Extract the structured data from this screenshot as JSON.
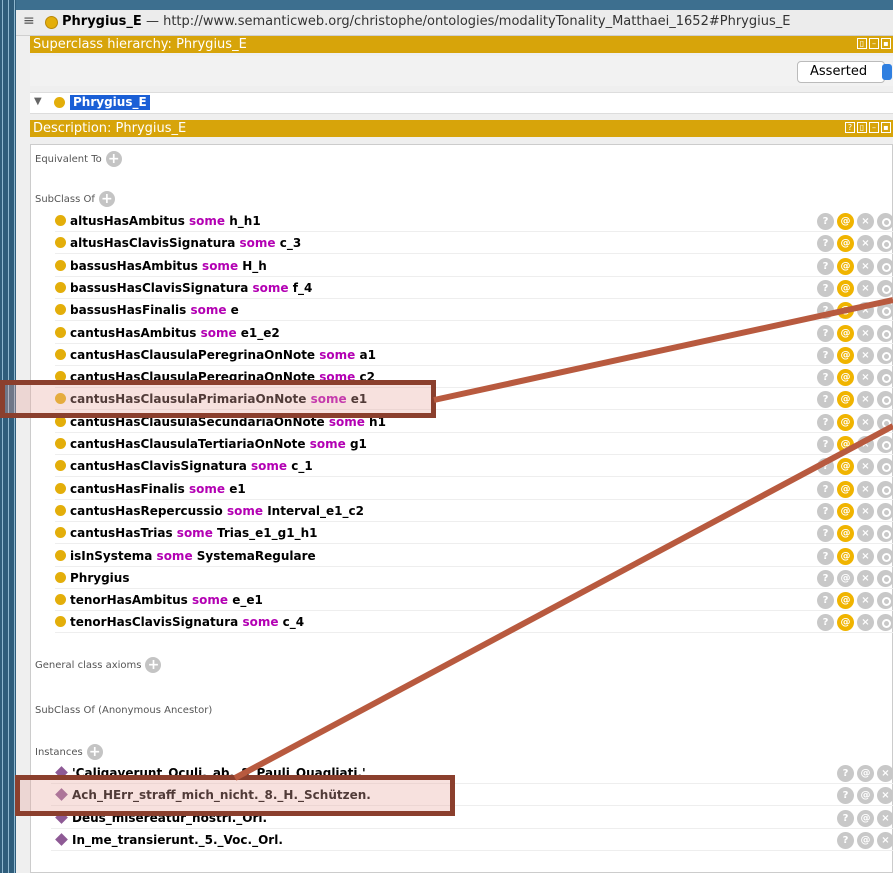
{
  "window": {
    "title_bold": "Phrygius_E",
    "title_rest": " — http://www.semanticweb.org/christophe/ontologies/modalityTonality_Matthaei_1652#Phrygius_E"
  },
  "superclass_panel": {
    "title": "Superclass hierarchy: Phrygius_E",
    "asserted_label": "Asserted",
    "tree_item": "Phrygius_E"
  },
  "description_panel": {
    "title": "Description: Phrygius_E",
    "equivalent_to": "Equivalent To",
    "subclass_of": "SubClass Of",
    "general_class_axioms": "General class axioms",
    "anonymous_ancestor": "SubClass Of (Anonymous Ancestor)",
    "instances_label": "Instances",
    "axioms": [
      {
        "prop": "altusHasAmbitus",
        "kw": "some",
        "val": "h_h1"
      },
      {
        "prop": "altusHasClavisSignatura",
        "kw": "some",
        "val": "c_3"
      },
      {
        "prop": "bassusHasAmbitus",
        "kw": "some",
        "val": "H_h"
      },
      {
        "prop": "bassusHasClavisSignatura",
        "kw": "some",
        "val": "f_4"
      },
      {
        "prop": "bassusHasFinalis",
        "kw": "some",
        "val": "e"
      },
      {
        "prop": "cantusHasAmbitus",
        "kw": "some",
        "val": "e1_e2"
      },
      {
        "prop": "cantusHasClausulaPeregrinaOnNote",
        "kw": "some",
        "val": "a1"
      },
      {
        "prop": "cantusHasClausulaPeregrinaOnNote",
        "kw": "some",
        "val": "c2"
      },
      {
        "prop": "cantusHasClausulaPrimariaOnNote",
        "kw": "some",
        "val": "e1"
      },
      {
        "prop": "cantusHasClausulaSecundariaOnNote",
        "kw": "some",
        "val": "h1"
      },
      {
        "prop": "cantusHasClausulaTertiariaOnNote",
        "kw": "some",
        "val": "g1"
      },
      {
        "prop": "cantusHasClavisSignatura",
        "kw": "some",
        "val": "c_1"
      },
      {
        "prop": "cantusHasFinalis",
        "kw": "some",
        "val": "e1"
      },
      {
        "prop": "cantusHasRepercussio",
        "kw": "some",
        "val": "Interval_e1_c2"
      },
      {
        "prop": "cantusHasTrias",
        "kw": "some",
        "val": "Trias_e1_g1_h1"
      },
      {
        "prop": "isInSystema",
        "kw": "some",
        "val": "SystemaRegulare"
      },
      {
        "prop": "Phrygius",
        "kw": "",
        "val": ""
      },
      {
        "prop": "tenorHasAmbitus",
        "kw": "some",
        "val": "e_e1"
      },
      {
        "prop": "tenorHasClavisSignatura",
        "kw": "some",
        "val": "c_4"
      }
    ],
    "instances": [
      "'Caligaverunt_Oculi._ab._&_Pauli_Quagliati.'",
      "Ach_HErr_straff_mich_nicht._8._H._Schützen.",
      "Deus_misereatur_nostri._Orl.",
      "In_me_transierunt._5._Voc._Orl."
    ]
  },
  "icons": {
    "help": "?",
    "at": "@",
    "delete": "×",
    "plus": "+"
  }
}
